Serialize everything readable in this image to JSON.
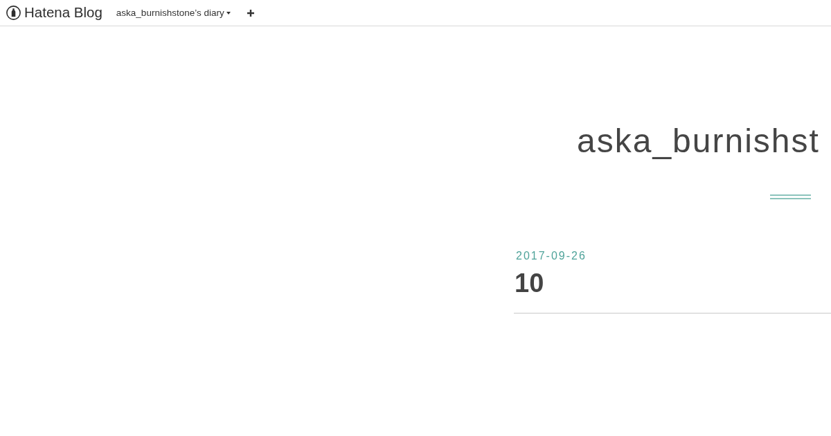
{
  "header": {
    "logo": "Hatena Blog",
    "blog_menu": "aska_burnishstone’s diary"
  },
  "blog_title": "aska_burnishst",
  "entry": {
    "date": "2017-09-26",
    "title": "10"
  }
}
